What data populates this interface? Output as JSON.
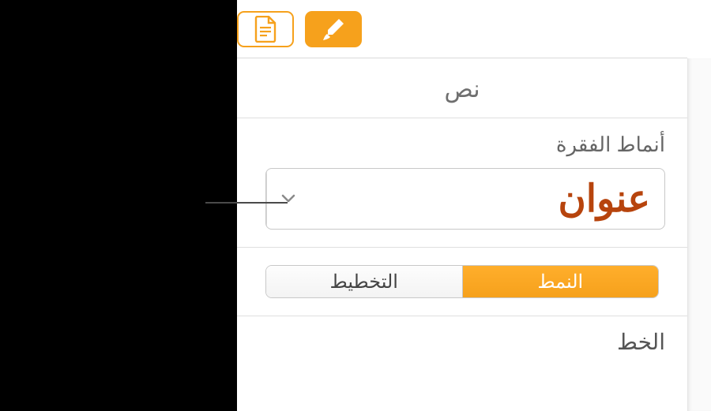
{
  "toolbar": {
    "format_tab_icon": "brush-icon",
    "document_tab_icon": "document-icon"
  },
  "section": {
    "title": "نص"
  },
  "paragraph_styles": {
    "label": "أنماط الفقرة",
    "selected": "عنوان"
  },
  "tabs": {
    "style": "النمط",
    "layout": "التخطيط"
  },
  "font": {
    "label": "الخط"
  },
  "colors": {
    "accent": "#f6a11c",
    "title_text": "#b7440d"
  }
}
